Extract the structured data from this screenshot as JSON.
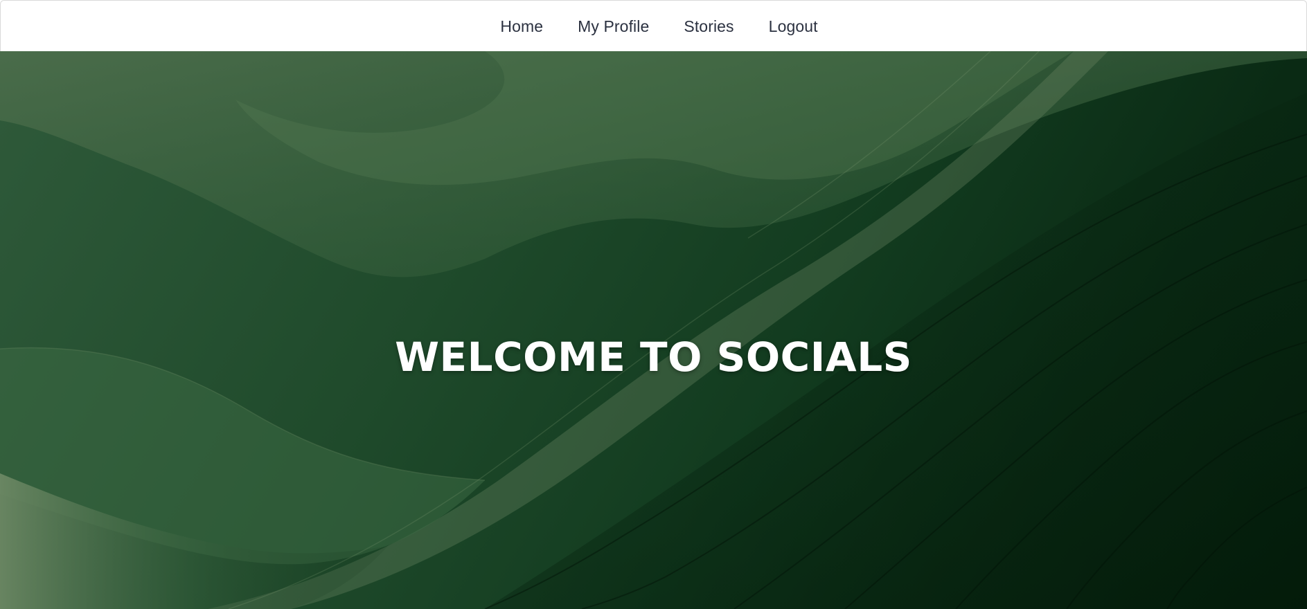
{
  "nav": {
    "items": [
      {
        "label": "Home"
      },
      {
        "label": "My Profile"
      },
      {
        "label": "Stories"
      },
      {
        "label": "Logout"
      }
    ]
  },
  "hero": {
    "title": "WELCOME TO SOCIALS"
  },
  "colors": {
    "nav_text": "#2b3140",
    "hero_green_light": "#4a6f4c",
    "hero_green_dark": "#05200e",
    "hero_title": "#ffffff"
  }
}
